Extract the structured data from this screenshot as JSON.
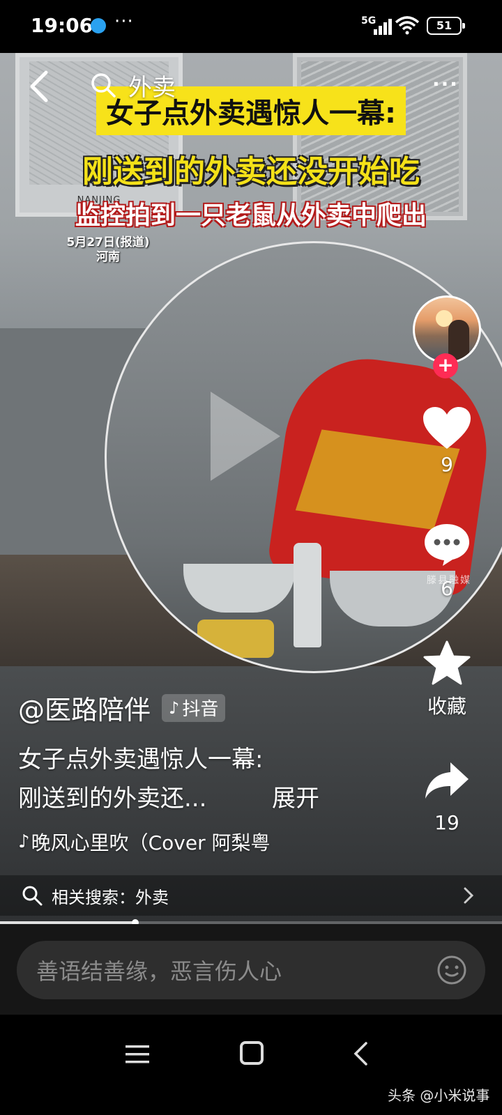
{
  "status_bar": {
    "time": "19:06",
    "more": "···",
    "network": "5G",
    "battery": "51"
  },
  "top_nav": {
    "search_query": "外卖",
    "more": "···"
  },
  "video": {
    "frame_caption": "NANJING",
    "headline_1": "女子点外卖遇惊人一幕:",
    "headline_2": "刚送到的外卖还没开始吃",
    "headline_3": "监控拍到一只老鼠从外卖中爬出",
    "date_line1": "5月27日(报道)",
    "date_line2": "河南",
    "watermark": "滕县融媒"
  },
  "actions": {
    "follow": "+",
    "like_count": "9",
    "comment_count": "6",
    "collect_label": "收藏",
    "share_count": "19"
  },
  "info": {
    "author": "@医路陪伴",
    "platform": "抖音",
    "caption_line1": "女子点外卖遇惊人一幕:",
    "caption_line2": "刚送到的外卖还...",
    "expand": "展开",
    "music": "晚风心里吹（Cover 阿梨粤"
  },
  "related": {
    "text": "相关搜索：外卖"
  },
  "progress": {
    "value": 0.27
  },
  "comment": {
    "placeholder": "善语结善缘，恶言伤人心"
  },
  "footer": {
    "source": "头条 @小米说事"
  },
  "colors": {
    "accent_yellow": "#f7e21a",
    "follow_red": "#fe2c55"
  }
}
